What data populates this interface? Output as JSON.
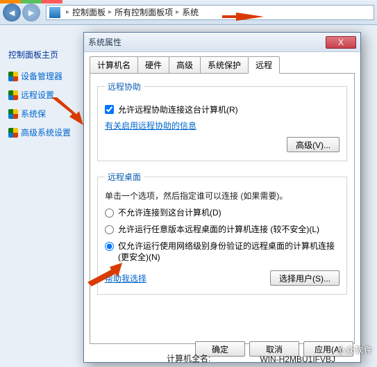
{
  "breadcrumb": {
    "item1": "控制面板",
    "item2": "所有控制面板项",
    "item3": "系统"
  },
  "sidebar": {
    "heading": "控制面板主页",
    "items": [
      {
        "label": "设备管理器"
      },
      {
        "label": "远程设置"
      },
      {
        "label": "系统保"
      },
      {
        "label": "高级系统设置"
      }
    ]
  },
  "dialog": {
    "title": "系统属性",
    "close": "X",
    "tabs": {
      "t0": "计算机名",
      "t1": "硬件",
      "t2": "高级",
      "t3": "系统保护",
      "t4": "远程"
    },
    "assist": {
      "legend": "远程协助",
      "checkbox": "允许远程协助连接这台计算机(R)",
      "link": "有关启用远程协助的信息",
      "adv_btn": "高级(V)..."
    },
    "desktop": {
      "legend": "远程桌面",
      "desc": "单击一个选项，然后指定谁可以连接 (如果需要)。",
      "opt1": "不允许连接到这台计算机(D)",
      "opt2": "允许运行任意版本远程桌面的计算机连接 (较不安全)(L)",
      "opt3": "仅允许运行使用网络级别身份验证的远程桌面的计算机连接 (更安全)(N)",
      "help": "帮助我选择",
      "select_btn": "选择用户(S)..."
    },
    "buttons": {
      "ok": "确定",
      "cancel": "取消",
      "apply": "应用(A)"
    }
  },
  "bottom": {
    "label": "计算机全名:",
    "value": "WIN-H2MBU1IFVBJ"
  },
  "watermark": "小众软件"
}
